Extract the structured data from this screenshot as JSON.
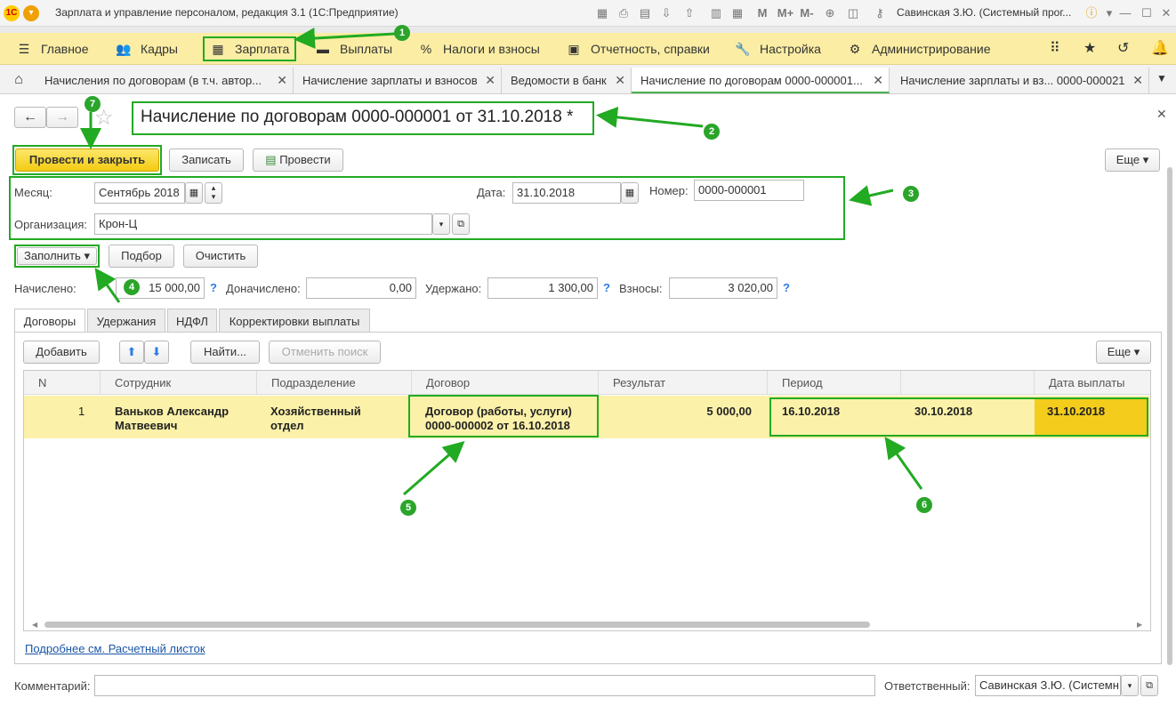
{
  "app": {
    "title": "Зарплата и управление персоналом, редакция 3.1 (1С:Предприятие)",
    "user": "Савинская З.Ю. (Системный прог...",
    "toolbar_m": "M",
    "toolbar_mplus": "M+",
    "toolbar_mminus": "M-"
  },
  "menu": [
    {
      "label": "Главное",
      "icon": "hamburger-icon"
    },
    {
      "label": "Кадры",
      "icon": "people-icon"
    },
    {
      "label": "Зарплата",
      "icon": "calculator-icon"
    },
    {
      "label": "Выплаты",
      "icon": "wallet-icon"
    },
    {
      "label": "Налоги и взносы",
      "icon": "percent-icon"
    },
    {
      "label": "Отчетность, справки",
      "icon": "reports-icon"
    },
    {
      "label": "Настройка",
      "icon": "wrench-icon"
    },
    {
      "label": "Администрирование",
      "icon": "gear-icon"
    }
  ],
  "tabs": [
    {
      "label": "Начисления по договорам (в т.ч. автор..."
    },
    {
      "label": "Начисление зарплаты и взносов"
    },
    {
      "label": "Ведомости в банк"
    },
    {
      "label": "Начисление по договорам 0000-000001..."
    },
    {
      "label": "Начисление зарплаты и вз... 0000-000021"
    }
  ],
  "doc": {
    "title": "Начисление по договорам 0000-000001 от 31.10.2018 *",
    "btn_post_close": "Провести и закрыть",
    "btn_save": "Записать",
    "btn_post": "Провести",
    "btn_more": "Еще",
    "month_label": "Месяц:",
    "month_value": "Сентябрь 2018",
    "date_label": "Дата:",
    "date_value": "31.10.2018",
    "number_label": "Номер:",
    "number_value": "0000-000001",
    "org_label": "Организация:",
    "org_value": "Крон-Ц",
    "btn_fill": "Заполнить",
    "btn_select": "Подбор",
    "btn_clear": "Очистить",
    "accrued_label": "Начислено:",
    "accrued_value": "15 000,00",
    "extra_label": "Доначислено:",
    "extra_value": "0,00",
    "withheld_label": "Удержано:",
    "withheld_value": "1 300,00",
    "contrib_label": "Взносы:",
    "contrib_value": "3 020,00",
    "question": "?"
  },
  "subtabs": [
    "Договоры",
    "Удержания",
    "НДФЛ",
    "Корректировки выплаты"
  ],
  "table_toolbar": {
    "add": "Добавить",
    "find": "Найти...",
    "cancel_search": "Отменить поиск",
    "more": "Еще"
  },
  "table": {
    "headers": [
      "N",
      "Сотрудник",
      "Подразделение",
      "Договор",
      "Результат",
      "Период",
      "",
      "Дата выплаты"
    ],
    "rows": [
      {
        "n": "1",
        "employee_1": "Ваньков Александр",
        "employee_2": "Матвеевич",
        "dept_1": "Хозяйственный",
        "dept_2": "отдел",
        "contract_1": "Договор (работы, услуги)",
        "contract_2": "0000-000002 от 16.10.2018",
        "result": "5 000,00",
        "period_from": "16.10.2018",
        "period_to": "30.10.2018",
        "pay_date": "31.10.2018"
      }
    ]
  },
  "footer": {
    "link": "Подробнее см. Расчетный листок",
    "comment_label": "Комментарий:",
    "responsible_label": "Ответственный:",
    "responsible_value": "Савинская З.Ю. (Системн"
  },
  "callouts": [
    "1",
    "2",
    "3",
    "4",
    "5",
    "6",
    "7"
  ],
  "colors": {
    "menu_bg": "#fbeea4",
    "primary_button": "#f7d320",
    "row_highlight": "#fbf1a9",
    "callout_green": "#22aa22"
  }
}
